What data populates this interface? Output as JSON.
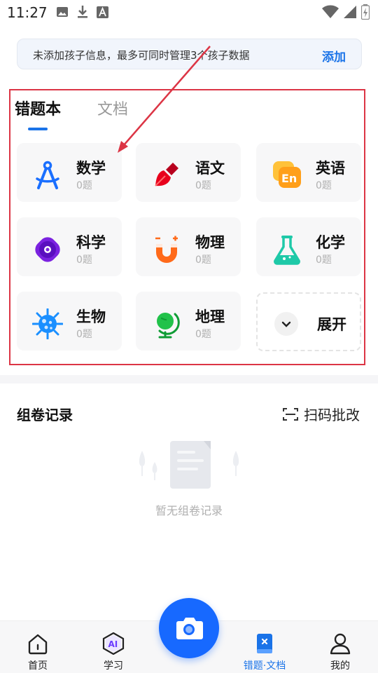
{
  "status_bar": {
    "time": "11:27"
  },
  "notice": {
    "text": "未添加孩子信息，最多可同时管理3个孩子数据",
    "action_label": "添加"
  },
  "tabs": [
    {
      "label": "错题本",
      "active": true
    },
    {
      "label": "文档",
      "active": false
    }
  ],
  "subjects": [
    {
      "name": "数学",
      "count": "0题",
      "icon": "compass-icon"
    },
    {
      "name": "语文",
      "count": "0题",
      "icon": "brush-icon"
    },
    {
      "name": "英语",
      "count": "0题",
      "icon": "english-bubble-icon"
    },
    {
      "name": "科学",
      "count": "0题",
      "icon": "atom-icon"
    },
    {
      "name": "物理",
      "count": "0题",
      "icon": "magnet-icon"
    },
    {
      "name": "化学",
      "count": "0题",
      "icon": "flask-icon"
    },
    {
      "name": "生物",
      "count": "0题",
      "icon": "virus-icon"
    },
    {
      "name": "地理",
      "count": "0题",
      "icon": "globe-icon"
    }
  ],
  "expand_label": "展开",
  "records": {
    "title": "组卷记录",
    "scan_label": "扫码批改",
    "empty_text": "暂无组卷记录"
  },
  "bottom_nav": [
    {
      "label": "首页",
      "icon": "home-icon",
      "active": false
    },
    {
      "label": "学习",
      "icon": "ai-hexagon-icon",
      "active": false
    },
    {
      "label": "错题·文档",
      "icon": "notebook-icon",
      "active": true
    },
    {
      "label": "我的",
      "icon": "person-icon",
      "active": false
    }
  ],
  "colors": {
    "accent": "#1a73e8",
    "fab": "#1769ff",
    "annotation": "#dc3545"
  }
}
